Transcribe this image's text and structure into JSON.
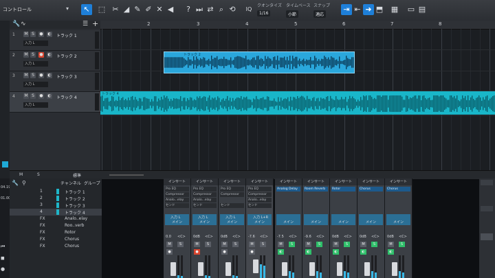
{
  "app": {
    "toolbar": {
      "control_label": "コントロール",
      "quantize": {
        "label": "クオンタイズ",
        "value": "1/16"
      },
      "timebase": {
        "label": "タイムベース",
        "value": "小節"
      },
      "snap": {
        "label": "スナップ",
        "value": "適応"
      }
    },
    "ruler": {
      "bars": [
        "2",
        "3",
        "4",
        "5",
        "6",
        "7",
        "8"
      ]
    },
    "tracks": [
      {
        "num": "1",
        "name": "トラック 1",
        "input": "入力 L",
        "selected": false,
        "armed": false
      },
      {
        "num": "2",
        "name": "トラック 2",
        "input": "入力 L",
        "selected": false,
        "armed": true
      },
      {
        "num": "3",
        "name": "トラック 3",
        "input": "入力 L",
        "selected": false,
        "armed": false
      },
      {
        "num": "4",
        "name": "トラック 4",
        "input": "入力 L",
        "selected": true,
        "armed": false
      }
    ],
    "clips": {
      "clip2_title": "トラック 2",
      "clip4_title": "トラック 4"
    },
    "midbar": {
      "m": "M",
      "s": "S",
      "standard": "標準"
    },
    "mixer_list": {
      "headers": {
        "channel": "チャンネル",
        "group": "グループ"
      },
      "rows": [
        {
          "num": "1",
          "name": "トラック 1",
          "selected": false
        },
        {
          "num": "2",
          "name": "トラック 2",
          "selected": false
        },
        {
          "num": "3",
          "name": "トラック 3",
          "selected": false
        },
        {
          "num": "4",
          "name": "トラック 4",
          "selected": true
        },
        {
          "num": "FX",
          "name": "Analo..elay",
          "selected": false
        },
        {
          "num": "FX",
          "name": "Roo..verb",
          "selected": false
        },
        {
          "num": "FX",
          "name": "Rotor",
          "selected": false
        },
        {
          "num": "FX",
          "name": "Chorus",
          "selected": false
        },
        {
          "num": "FX",
          "name": "Chorus",
          "selected": false
        }
      ]
    },
    "time_col": [
      "04.19",
      "01.00"
    ],
    "strips": [
      {
        "insert": "インサート",
        "slots": [
          "Pro EQ",
          "Compressor",
          "Analo...elay"
        ],
        "send": "センド",
        "input": "入力 L",
        "sub": "メイン",
        "vol": "0.0",
        "pan": "<C>",
        "active": false
      },
      {
        "insert": "インサート",
        "slots": [
          "Pro EQ",
          "Compressor",
          "Analo...elay"
        ],
        "send": "センド",
        "input": "入力 L",
        "sub": "メイン",
        "vol": "0dB",
        "pan": "<C>",
        "active": false
      },
      {
        "insert": "インサート",
        "slots": [
          "Pro EQ",
          "Compressor"
        ],
        "send": "センド",
        "input": "入力 L",
        "sub": "メイン",
        "vol": "0dB",
        "pan": "<C>",
        "active": false
      },
      {
        "insert": "インサート",
        "slots": [
          "Pro EQ",
          "Compressor",
          "Analo...elay"
        ],
        "send": "センド",
        "input": "入力 L+R",
        "sub": "メイン",
        "vol": "-7.6",
        "pan": "<C>",
        "active": true
      },
      {
        "insert": "インサート",
        "slots": [
          "Analog Delay"
        ],
        "send": "",
        "input": "",
        "sub": "メイン",
        "vol": "-7.5",
        "pan": "<C>",
        "active": false
      },
      {
        "insert": "インサート",
        "slots": [
          "Room Reverb"
        ],
        "send": "",
        "input": "",
        "sub": "メイン",
        "vol": "-9.6",
        "pan": "<C>",
        "active": false
      },
      {
        "insert": "インサート",
        "slots": [
          "Rotor"
        ],
        "send": "",
        "input": "",
        "sub": "メイン",
        "vol": "0dB",
        "pan": "<C>",
        "active": false
      },
      {
        "insert": "インサート",
        "slots": [
          "Chorus"
        ],
        "send": "",
        "input": "",
        "sub": "メイン",
        "vol": "0dB",
        "pan": "<C>",
        "active": false
      },
      {
        "insert": "インサート",
        "slots": [
          "Chorus"
        ],
        "send": "",
        "input": "",
        "sub": "メイン",
        "vol": "0dB",
        "pan": "<C>",
        "active": false
      }
    ],
    "colors": {
      "accent": "#1e7fd8",
      "clip2": "#2aa7dc",
      "clip4": "#19b6c9",
      "record": "#d9452f",
      "solo": "#2fbf6a"
    }
  }
}
